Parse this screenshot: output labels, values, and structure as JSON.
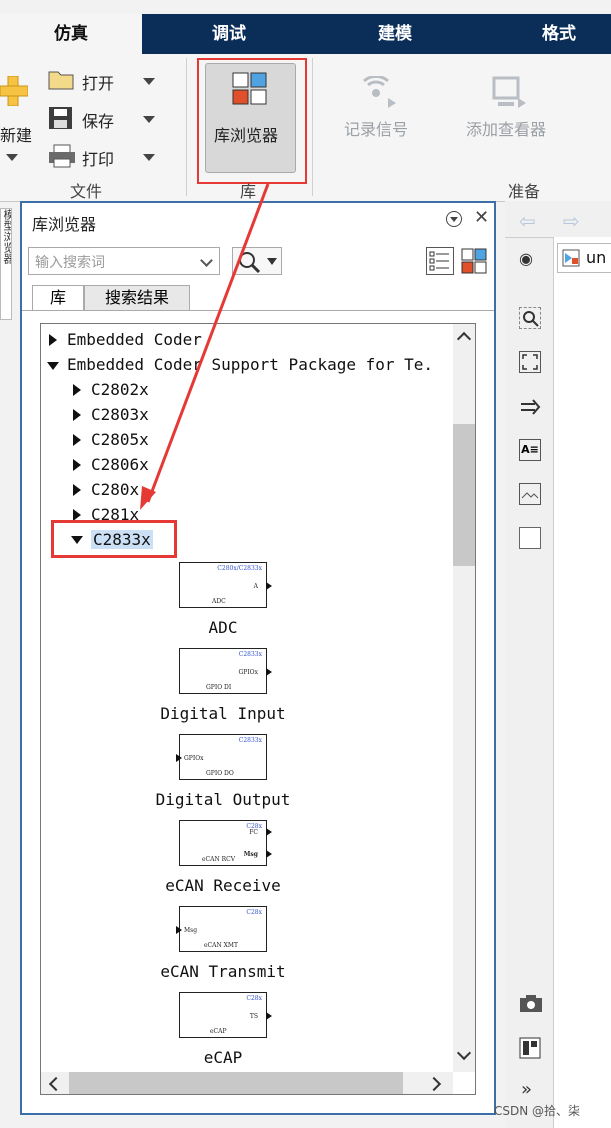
{
  "tabs": [
    {
      "label": "仿真",
      "active": true
    },
    {
      "label": "调试",
      "active": false
    },
    {
      "label": "建模",
      "active": false
    },
    {
      "label": "格式",
      "active": false
    }
  ],
  "ribbon": {
    "new_label": "新建",
    "open_label": "打开",
    "save_label": "保存",
    "print_label": "打印",
    "file_group": "文件",
    "library_browser_label": "库浏览器",
    "library_group": "库",
    "record_signal_label": "记录信号",
    "add_viewer_label": "添加查看器",
    "prepare_group": "准备"
  },
  "side_tab_label": "模型浏览器",
  "panel": {
    "title": "库浏览器",
    "search_placeholder": "输入搜索词",
    "tabs": [
      "库",
      "搜索结果"
    ],
    "tree": [
      {
        "label": "Embedded Coder",
        "level": 0,
        "expanded": false
      },
      {
        "label": "Embedded Coder Support Package for Te.",
        "level": 0,
        "expanded": true
      },
      {
        "label": "C2802x",
        "level": 1,
        "expanded": false
      },
      {
        "label": "C2803x",
        "level": 1,
        "expanded": false
      },
      {
        "label": "C2805x",
        "level": 1,
        "expanded": false
      },
      {
        "label": "C2806x",
        "level": 1,
        "expanded": false
      },
      {
        "label": "C280x",
        "level": 1,
        "expanded": false
      },
      {
        "label": "C281x",
        "level": 1,
        "expanded": false
      },
      {
        "label": "C2833x",
        "level": 1,
        "expanded": true,
        "selected": true
      }
    ],
    "blocks": [
      {
        "name": "ADC",
        "top": "C280x/C2833x",
        "in": "",
        "out": "A",
        "bottom": "ADC"
      },
      {
        "name": "Digital Input",
        "top": "C2833x",
        "in": "",
        "out": "GPIOx",
        "bottom": "GPIO DI"
      },
      {
        "name": "Digital Output",
        "top": "C2833x",
        "in": "GPIOx",
        "out": "",
        "bottom": "GPIO DO"
      },
      {
        "name": "eCAN Receive",
        "top": "C28x",
        "in": "",
        "out": "Msg",
        "bottom": "eCAN RCV"
      },
      {
        "name": "eCAN Transmit",
        "top": "C28x",
        "in": "Msg",
        "out": "",
        "bottom": "eCAN XMT"
      },
      {
        "name": "eCAP",
        "top": "C28x",
        "in": "",
        "out": "TS",
        "bottom": "eCAP"
      }
    ]
  },
  "right": {
    "tab_label": "un"
  },
  "watermark": "CSDN @拾、柒",
  "colors": {
    "tab_bar": "#0b2e59",
    "highlight_red": "#e53935",
    "panel_border": "#3c6ea8"
  }
}
